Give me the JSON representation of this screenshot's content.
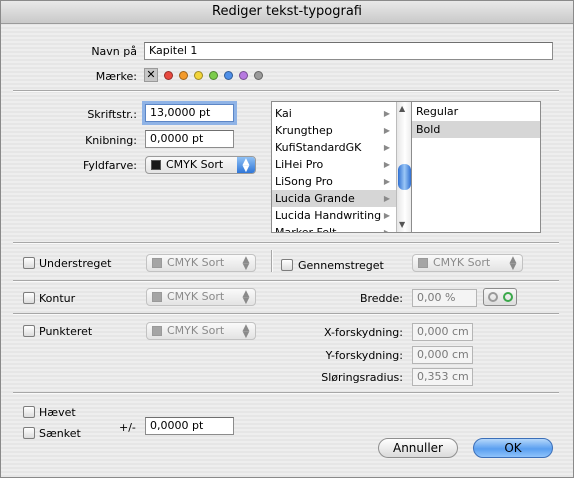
{
  "window": {
    "title": "Rediger tekst-typografi"
  },
  "name": {
    "label": "Navn på",
    "value": "Kapitel 1"
  },
  "mark": {
    "label": "Mærke:",
    "colors": [
      "#e8493f",
      "#f39a2b",
      "#f2d43a",
      "#7ccc4b",
      "#4e8fe8",
      "#b77ae0",
      "#9b9b9b"
    ]
  },
  "font_size": {
    "label": "Skriftstr.:",
    "value": "13,0000 pt"
  },
  "kerning": {
    "label": "Knibning:",
    "value": "0,0000 pt"
  },
  "fill": {
    "label": "Fyldfarve:",
    "value": "CMYK Sort"
  },
  "font_list": [
    "Kai",
    "Krungthep",
    "KufiStandardGK",
    "LiHei Pro",
    "LiSong Pro",
    "Lucida Grande",
    "Lucida Handwriting",
    "Marker Felt"
  ],
  "font_selected_index": 5,
  "style_list": [
    "Regular",
    "Bold"
  ],
  "style_selected_index": 1,
  "underline": {
    "label": "Understreget",
    "color": "CMYK Sort"
  },
  "strike": {
    "label": "Gennemstreget",
    "color": "CMYK Sort"
  },
  "outline": {
    "label": "Kontur",
    "color": "CMYK Sort",
    "width_label": "Bredde:",
    "width_value": "0,00 %"
  },
  "dotted": {
    "label": "Punkteret",
    "color": "CMYK Sort"
  },
  "offsets": {
    "x_label": "X-forskydning:",
    "x_value": "0,000 cm",
    "y_label": "Y-forskydning:",
    "y_value": "0,000 cm",
    "blur_label": "Sløringsradius:",
    "blur_value": "0,353 cm"
  },
  "raised": {
    "label": "Hævet"
  },
  "lowered": {
    "label": "Sænket"
  },
  "baseline": {
    "label": "+/-",
    "value": "0,0000 pt"
  },
  "buttons": {
    "cancel": "Annuller",
    "ok": "OK"
  }
}
